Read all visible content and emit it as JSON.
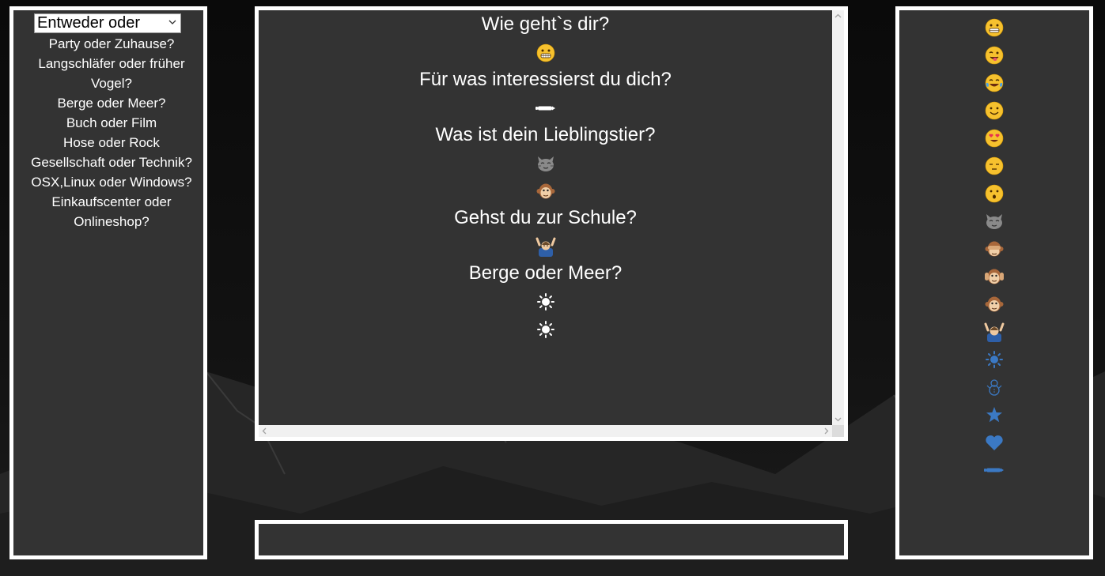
{
  "category_select": {
    "selected": "Entweder oder"
  },
  "questions": [
    "Party oder Zuhause?",
    "Langschläfer oder früher Vogel?",
    "Berge oder Meer?",
    "Buch oder Film",
    "Hose oder Rock",
    "Gesellschaft oder Technik?",
    "OSX,Linux oder Windows?",
    "Einkaufscenter oder Onlineshop?"
  ],
  "chat": [
    {
      "type": "question",
      "text": "Wie geht`s dir?"
    },
    {
      "type": "emoji",
      "icon": "grinning-face-icon"
    },
    {
      "type": "question",
      "text": "Für was interessierst du dich?"
    },
    {
      "type": "emoji",
      "icon": "pen-icon"
    },
    {
      "type": "question",
      "text": "Was ist dein Lieblingstier?"
    },
    {
      "type": "emoji",
      "icon": "cat-face-icon"
    },
    {
      "type": "emoji",
      "icon": "monkey-face-icon"
    },
    {
      "type": "question",
      "text": "Gehst du zur Schule?"
    },
    {
      "type": "emoji",
      "icon": "raising-hands-person-icon"
    },
    {
      "type": "question",
      "text": "Berge oder Meer?"
    },
    {
      "type": "emoji",
      "icon": "sun-icon"
    },
    {
      "type": "emoji",
      "icon": "sun-icon"
    }
  ],
  "emoji_palette": [
    "grinning-face-icon",
    "winking-tongue-face-icon",
    "tears-of-joy-face-icon",
    "smiling-face-icon",
    "heart-eyes-face-icon",
    "pensive-face-icon",
    "kissing-face-icon",
    "cat-face-icon",
    "see-no-evil-monkey-icon",
    "hear-no-evil-monkey-icon",
    "monkey-face-icon",
    "raising-hands-person-icon",
    "sun-icon",
    "snowman-icon",
    "star-icon",
    "heart-icon",
    "pen-icon"
  ],
  "colors": {
    "panel_bg": "#333333",
    "border": "#ffffff",
    "text": "#ffffff",
    "blue_icon": "#3b79c4",
    "emoji_yellow": "#f6c12e"
  }
}
